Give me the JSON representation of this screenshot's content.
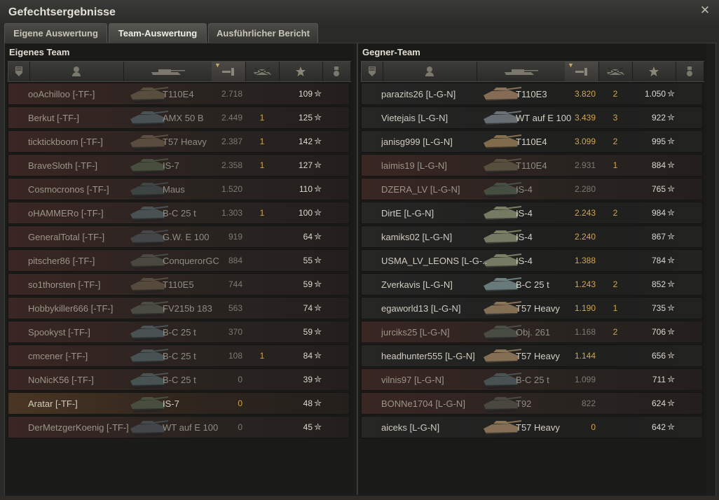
{
  "window": {
    "title": "Gefechtsergebnisse",
    "close_icon": "close-icon"
  },
  "tabs": [
    {
      "label": "Eigene Auswertung",
      "active": false
    },
    {
      "label": "Team-Auswertung",
      "active": true
    },
    {
      "label": "Ausführlicher Bericht",
      "active": false
    }
  ],
  "columns": [
    {
      "icon": "rank-badge-icon"
    },
    {
      "icon": "player-icon"
    },
    {
      "icon": "tank-icon"
    },
    {
      "icon": "damage-icon",
      "sorted": true
    },
    {
      "icon": "destroyed-tank-icon"
    },
    {
      "icon": "star-icon"
    },
    {
      "icon": "medal-icon"
    }
  ],
  "own_team": {
    "title": "Eigenes Team",
    "players": [
      {
        "name": "ooAchilloo [-TF-]",
        "vehicle": "T110E4",
        "damage": "2.718",
        "kills": "",
        "xp": "109",
        "state": "dead",
        "tank_color": "#5a5040"
      },
      {
        "name": "Berkut [-TF-]",
        "vehicle": "AMX 50 B",
        "damage": "2.449",
        "kills": "1",
        "xp": "125",
        "state": "dead",
        "tank_color": "#4a5458"
      },
      {
        "name": "ticktickboom [-TF-]",
        "vehicle": "T57 Heavy",
        "damage": "2.387",
        "kills": "1",
        "xp": "142",
        "state": "dead",
        "tank_color": "#5c4f40"
      },
      {
        "name": "BraveSloth [-TF-]",
        "vehicle": "IS-7",
        "damage": "2.358",
        "kills": "1",
        "xp": "127",
        "state": "dead",
        "tank_color": "#4a5040"
      },
      {
        "name": "Cosmocronos [-TF-]",
        "vehicle": "Maus",
        "damage": "1.520",
        "kills": "",
        "xp": "110",
        "state": "dead",
        "tank_color": "#3e4646"
      },
      {
        "name": "oHAMMERo [-TF-]",
        "vehicle": "B-C 25 t",
        "damage": "1.303",
        "kills": "1",
        "xp": "100",
        "state": "dead",
        "tank_color": "#4a5456"
      },
      {
        "name": "GeneralTotal [-TF-]",
        "vehicle": "G.W. E 100",
        "damage": "919",
        "kills": "",
        "xp": "64",
        "state": "dead",
        "tank_color": "#44484a"
      },
      {
        "name": "pitscher86 [-TF-]",
        "vehicle": "ConquerorGC",
        "damage": "884",
        "kills": "",
        "xp": "55",
        "state": "dead",
        "tank_color": "#4a4a42"
      },
      {
        "name": "so1thorsten [-TF-]",
        "vehicle": "T110E5",
        "damage": "744",
        "kills": "",
        "xp": "59",
        "state": "dead",
        "tank_color": "#574c3e"
      },
      {
        "name": "Hobbykiller666 [-TF-]",
        "vehicle": "FV215b 183",
        "damage": "563",
        "kills": "",
        "xp": "74",
        "state": "dead",
        "tank_color": "#4c4e44"
      },
      {
        "name": "Spookyst [-TF-]",
        "vehicle": "B-C 25 t",
        "damage": "370",
        "kills": "",
        "xp": "59",
        "state": "dead",
        "tank_color": "#4a5456"
      },
      {
        "name": "cmcener [-TF-]",
        "vehicle": "B-C 25 t",
        "damage": "108",
        "kills": "1",
        "xp": "84",
        "state": "dead",
        "tank_color": "#4a5456"
      },
      {
        "name": "NoNicK56 [-TF-]",
        "vehicle": "B-C 25 t",
        "damage": "0",
        "kills": "",
        "xp": "39",
        "state": "dead",
        "tank_color": "#4a5456"
      },
      {
        "name": "Aratar [-TF-]",
        "vehicle": "IS-7",
        "damage": "0",
        "kills": "",
        "xp": "48",
        "state": "self",
        "tank_color": "#4a5040"
      },
      {
        "name": "DerMetzgerKoenig [-TF-]",
        "vehicle": "WT auf E 100",
        "damage": "0",
        "kills": "",
        "xp": "45",
        "state": "dead",
        "tank_color": "#44494c"
      }
    ]
  },
  "enemy_team": {
    "title": "Gegner-Team",
    "players": [
      {
        "name": "parazits26 [L-G-N]",
        "vehicle": "T110E3",
        "damage": "3.820",
        "kills": "2",
        "xp": "1.050",
        "state": "alive",
        "tank_color": "#8a7257"
      },
      {
        "name": "Vietejais [L-G-N]",
        "vehicle": "WT auf E 100",
        "damage": "3.439",
        "kills": "3",
        "xp": "922",
        "state": "alive",
        "tank_color": "#6a7278"
      },
      {
        "name": "janisg999 [L-G-N]",
        "vehicle": "T110E4",
        "damage": "3.099",
        "kills": "2",
        "xp": "995",
        "state": "alive",
        "tank_color": "#86704f"
      },
      {
        "name": "laimis19 [L-G-N]",
        "vehicle": "T110E4",
        "damage": "2.931",
        "kills": "1",
        "xp": "884",
        "state": "dead",
        "tank_color": "#5a5040"
      },
      {
        "name": "DZERA_LV [L-G-N]",
        "vehicle": "IS-4",
        "damage": "2.280",
        "kills": "",
        "xp": "765",
        "state": "dead",
        "tank_color": "#485044"
      },
      {
        "name": "DirtE [L-G-N]",
        "vehicle": "IS-4",
        "damage": "2.243",
        "kills": "2",
        "xp": "984",
        "state": "alive",
        "tank_color": "#7a8066"
      },
      {
        "name": "kamiks02 [L-G-N]",
        "vehicle": "IS-4",
        "damage": "2.240",
        "kills": "",
        "xp": "867",
        "state": "alive",
        "tank_color": "#7a8066"
      },
      {
        "name": "USMA_LV_LEONS [L-G-..",
        "vehicle": "IS-4",
        "damage": "1.388",
        "kills": "",
        "xp": "784",
        "state": "alive",
        "tank_color": "#7a8066"
      },
      {
        "name": "Zverkavis [L-G-N]",
        "vehicle": "B-C 25 t",
        "damage": "1.243",
        "kills": "2",
        "xp": "852",
        "state": "alive",
        "tank_color": "#6e8080"
      },
      {
        "name": "egaworld13 [L-G-N]",
        "vehicle": "T57 Heavy",
        "damage": "1.190",
        "kills": "1",
        "xp": "735",
        "state": "alive",
        "tank_color": "#8a7458"
      },
      {
        "name": "jurciks25 [L-G-N]",
        "vehicle": "Obj. 261",
        "damage": "1.168",
        "kills": "2",
        "xp": "706",
        "state": "dead",
        "tank_color": "#4a4e44"
      },
      {
        "name": "headhunter555 [L-G-N]",
        "vehicle": "T57 Heavy",
        "damage": "1.144",
        "kills": "",
        "xp": "656",
        "state": "alive",
        "tank_color": "#8a7458"
      },
      {
        "name": "vilnis97 [L-G-N]",
        "vehicle": "B-C 25 t",
        "damage": "1.099",
        "kills": "",
        "xp": "711",
        "state": "dead",
        "tank_color": "#4a5456"
      },
      {
        "name": "BONNe1704 [L-G-N]",
        "vehicle": "T92",
        "damage": "822",
        "kills": "",
        "xp": "624",
        "state": "dead",
        "tank_color": "#4a4a42"
      },
      {
        "name": "aiceks [L-G-N]",
        "vehicle": "T57 Heavy",
        "damage": "0",
        "kills": "",
        "xp": "642",
        "state": "alive",
        "tank_color": "#8a7458"
      }
    ]
  }
}
